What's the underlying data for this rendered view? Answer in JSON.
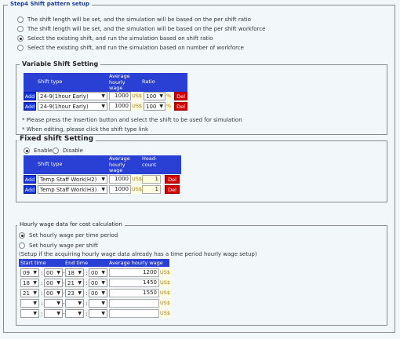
{
  "step": {
    "title": "Step4  Shift pattern setup"
  },
  "modes": [
    {
      "label": "The shift length will be set, and the simulation will be based on the per shift ratio",
      "selected": false
    },
    {
      "label": "The shift length will be set, and the simulation will be based on the per shift workforce",
      "selected": false
    },
    {
      "label": "Select the existing shift, and run the simulation based on shift ratio",
      "selected": true
    },
    {
      "label": "Select the existing shift, and run the simulation based on number of workforce",
      "selected": false
    }
  ],
  "variable": {
    "title": "Variable Shift Setting",
    "headers": {
      "shift_type": "Shift type",
      "wage": "Average hourly wage",
      "ratio": "Ratio"
    },
    "rows": [
      {
        "add": "Add",
        "shift": "24-9(1hour Early)",
        "wage": "1000",
        "unit": "US$",
        "ratio": "100",
        "pct": "%",
        "del": "Del"
      },
      {
        "add": "Add",
        "shift": "24-9(1hour Early)",
        "wage": "1000",
        "unit": "US$",
        "ratio": "100",
        "pct": "%",
        "del": "Del"
      }
    ],
    "note1": "* Please press the insertion button and select the shift to be used for simulation",
    "note2": "* When editing, please click the shift type link"
  },
  "fixed": {
    "title": "Fixed shift Setting",
    "enable_label": "Enable",
    "disable_label": "Disable",
    "enabled": true,
    "headers": {
      "shift_type": "Shift type",
      "wage": "Average hourly wage",
      "head": "Head-count"
    },
    "rows": [
      {
        "add": "Add",
        "shift": "Temp Staff Work(H2)",
        "wage": "1000",
        "unit": "US$",
        "count": "1",
        "del": "Del"
      },
      {
        "add": "Add",
        "shift": "Temp Staff Work(H3)",
        "wage": "1000",
        "unit": "US$",
        "count": "1",
        "del": "Del"
      }
    ]
  },
  "hourly": {
    "title": "Hourly wage data for cost calculation",
    "opt1": "Set hourly wage per time period",
    "opt2": "Set hourly wage per shift",
    "opt1_selected": true,
    "note": "(Setup if the acquiring hourly wage data already has a time period hourly wage setup)",
    "headers": {
      "start": "Start time",
      "end": "End time",
      "wage": "Average hourly wage"
    },
    "rows": [
      {
        "sh": "09",
        "sm": "00",
        "eh": "18",
        "em": "00",
        "wage": "1200",
        "unit": "US$"
      },
      {
        "sh": "18",
        "sm": "00",
        "eh": "21",
        "em": "00",
        "wage": "1450",
        "unit": "US$"
      },
      {
        "sh": "21",
        "sm": "00",
        "eh": "23",
        "em": "00",
        "wage": "1550",
        "unit": "US$"
      },
      {
        "sh": "",
        "sm": "",
        "eh": "",
        "em": "",
        "wage": "",
        "unit": "US$"
      },
      {
        "sh": "",
        "sm": "",
        "eh": "",
        "em": "",
        "wage": "",
        "unit": "US$"
      }
    ]
  }
}
